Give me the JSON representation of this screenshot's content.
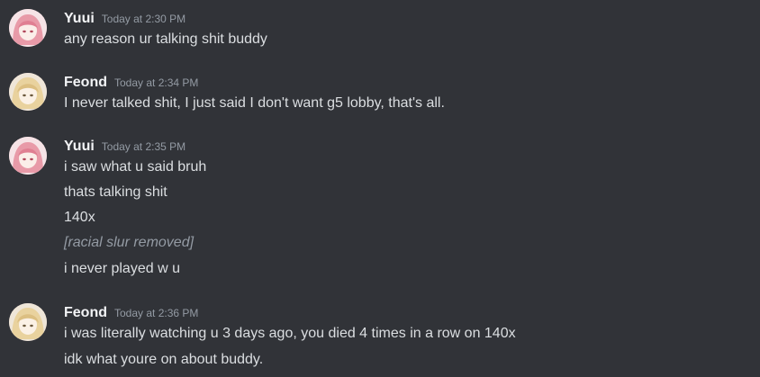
{
  "colors": {
    "background": "#313338",
    "username": "#f2f3f5",
    "timestamp": "#949ba4",
    "message_text": "#dbdee1",
    "avatar_yuui": "pink-haired anime avatar",
    "avatar_feond": "blonde-haired anime avatar"
  },
  "messages": [
    {
      "author": "Yuui",
      "timestamp": "Today at 2:30 PM",
      "avatar_icon": "user-avatar-icon",
      "lines": [
        "any reason ur talking shit buddy"
      ]
    },
    {
      "author": "Feond",
      "timestamp": "Today at 2:34 PM",
      "avatar_icon": "user-avatar-icon",
      "lines": [
        "I never talked shit, I just said I don't want g5 lobby, that's all."
      ]
    },
    {
      "author": "Yuui",
      "timestamp": "Today at 2:35 PM",
      "avatar_icon": "user-avatar-icon",
      "lines": [
        "i saw what u said bruh",
        "thats talking shit",
        "140x",
        "[racial slur removed]",
        "i never played w u"
      ]
    },
    {
      "author": "Feond",
      "timestamp": "Today at 2:36 PM",
      "avatar_icon": "user-avatar-icon",
      "lines": [
        "i was literally watching u 3 days ago, you died 4 times in a row on 140x",
        "idk what youre on about buddy."
      ]
    }
  ]
}
